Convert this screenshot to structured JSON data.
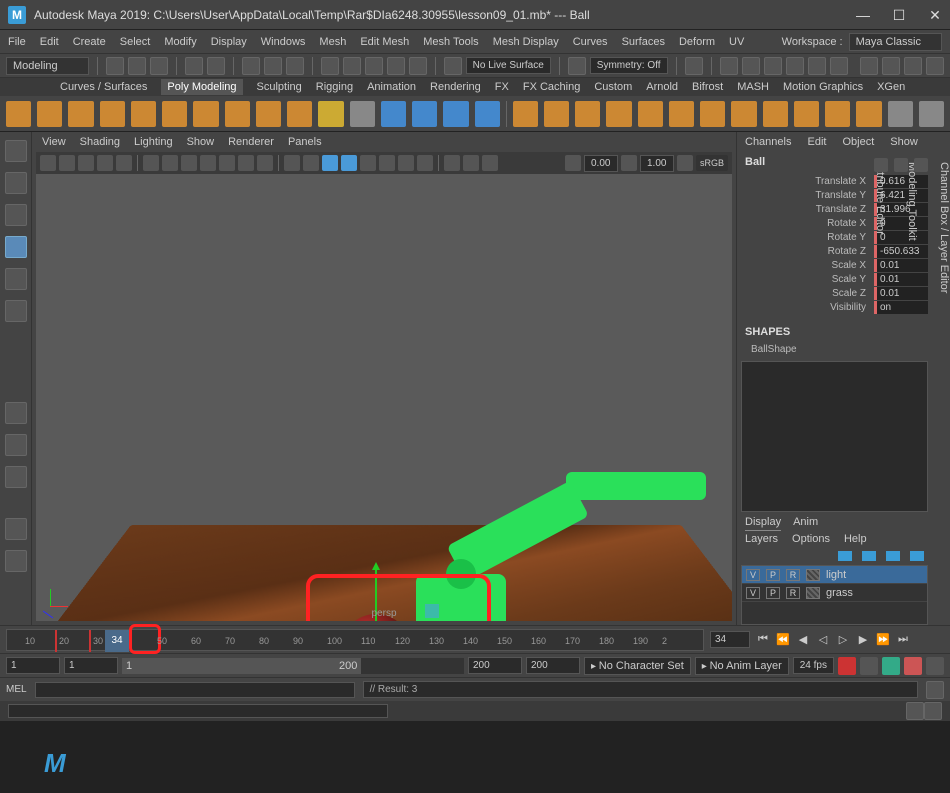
{
  "title": "Autodesk Maya 2019: C:\\Users\\User\\AppData\\Local\\Temp\\Rar$DIa6248.30955\\lesson09_01.mb*  ---  Ball",
  "menubar": [
    "File",
    "Edit",
    "Create",
    "Select",
    "Modify",
    "Display",
    "Windows",
    "Mesh",
    "Edit Mesh",
    "Mesh Tools",
    "Mesh Display",
    "Curves",
    "Surfaces",
    "Deform",
    "UV"
  ],
  "workspace_label": "Workspace :",
  "workspace_value": "Maya Classic",
  "modeling_dd": "Modeling",
  "no_live": "No Live Surface",
  "symmetry": "Symmetry: Off",
  "shelf_tabs": [
    "Curves / Surfaces",
    "Poly Modeling",
    "Sculpting",
    "Rigging",
    "Animation",
    "Rendering",
    "FX",
    "FX Caching",
    "Custom",
    "Arnold",
    "Bifrost",
    "MASH",
    "Motion Graphics",
    "XGen"
  ],
  "shelf_active": "Poly Modeling",
  "vp_menu": [
    "View",
    "Shading",
    "Lighting",
    "Show",
    "Renderer",
    "Panels"
  ],
  "vp_camera": "persp",
  "vp_field1": "0.00",
  "vp_field2": "1.00",
  "vp_srgb": "sRGB",
  "channel_tabs": [
    "Channels",
    "Edit",
    "Object",
    "Show"
  ],
  "object_name": "Ball",
  "attrs": [
    {
      "label": "Translate X",
      "value": "0.616"
    },
    {
      "label": "Translate Y",
      "value": "6.421"
    },
    {
      "label": "Translate Z",
      "value": "31.996"
    },
    {
      "label": "Rotate X",
      "value": "0"
    },
    {
      "label": "Rotate Y",
      "value": "0"
    },
    {
      "label": "Rotate Z",
      "value": "-650.633"
    },
    {
      "label": "Scale X",
      "value": "0.01"
    },
    {
      "label": "Scale Y",
      "value": "0.01"
    },
    {
      "label": "Scale Z",
      "value": "0.01"
    },
    {
      "label": "Visibility",
      "value": "on"
    }
  ],
  "shapes_header": "SHAPES",
  "shape_name": "BallShape",
  "disp_tabs": [
    "Display",
    "Anim"
  ],
  "layer_menu": [
    "Layers",
    "Options",
    "Help"
  ],
  "layers": [
    {
      "v": "V",
      "p": "P",
      "r": "R",
      "name": "light",
      "sel": true
    },
    {
      "v": "V",
      "p": "P",
      "r": "R",
      "name": "grass",
      "sel": false
    }
  ],
  "side_tabs": [
    "Channel Box / Layer Editor",
    "Modeling Toolkit",
    "Attribute Editor"
  ],
  "timeline_ticks": [
    "10",
    "20",
    "30",
    "50",
    "60",
    "70",
    "80",
    "90",
    "100",
    "110",
    "120",
    "130",
    "140",
    "150",
    "160",
    "170",
    "180",
    "190",
    "2"
  ],
  "timeline_current": "34",
  "current_frame_field": "34",
  "range": {
    "start_outer": "1",
    "start_inner": "1",
    "end_inner": "200",
    "end_outer": "200",
    "slider_start": "1",
    "slider_end": "200"
  },
  "char_set": "No Character Set",
  "anim_layer": "No Anim Layer",
  "fps": "24 fps",
  "mel_label": "MEL",
  "cmd_result": "// Result: 3"
}
